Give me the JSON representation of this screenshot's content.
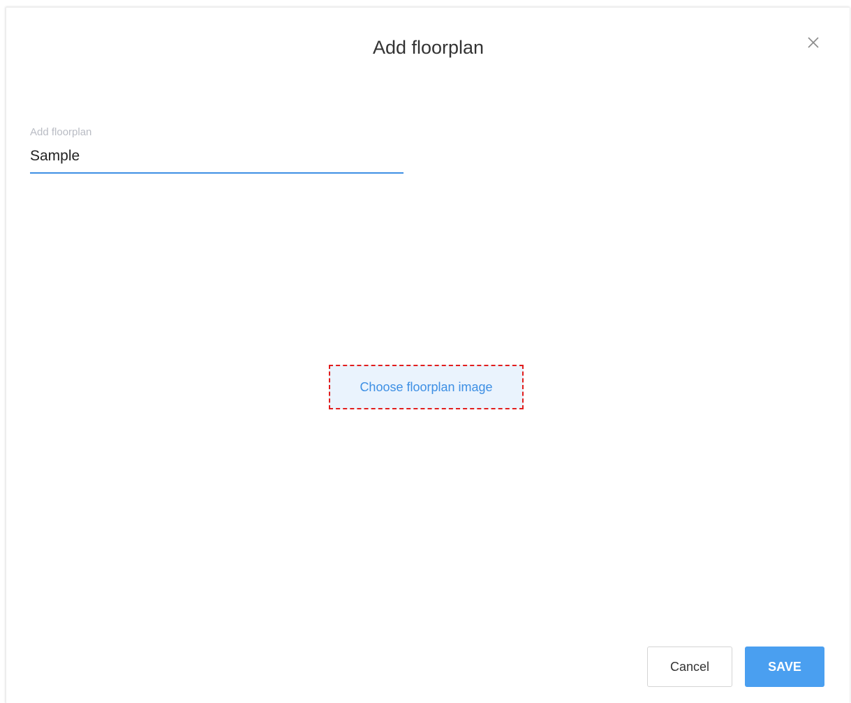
{
  "dialog": {
    "title": "Add floorplan",
    "close_icon": "close-icon"
  },
  "form": {
    "name_label": "Add floorplan",
    "name_value": "Sample"
  },
  "upload": {
    "button_label": "Choose floorplan image"
  },
  "footer": {
    "cancel_label": "Cancel",
    "save_label": "SAVE"
  },
  "colors": {
    "accent": "#3d8fe4",
    "save_button": "#4a9ff0",
    "upload_background": "#eaf3fd",
    "upload_dashed_border": "#e11d1d",
    "label_muted": "#b9bcc4"
  }
}
